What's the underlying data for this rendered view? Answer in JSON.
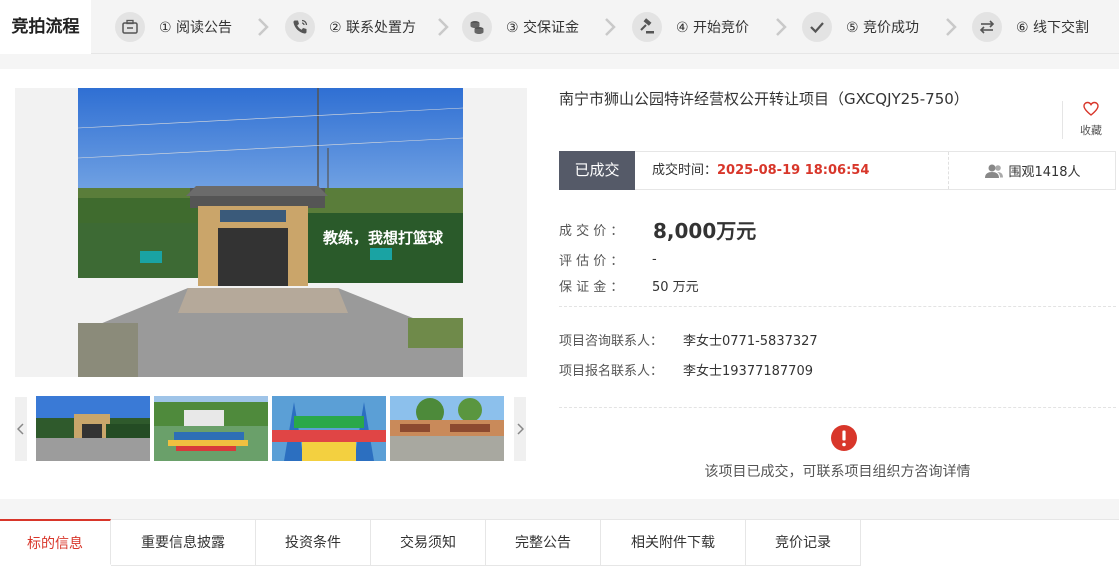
{
  "steps_title": "竞拍流程",
  "steps": [
    {
      "label": "① 阅读公告",
      "icon": "announcement-icon"
    },
    {
      "label": "② 联系处置方",
      "icon": "phone-icon"
    },
    {
      "label": "③ 交保证金",
      "icon": "coins-icon"
    },
    {
      "label": "④ 开始竞价",
      "icon": "gavel-icon"
    },
    {
      "label": "⑤ 竞价成功",
      "icon": "check-icon"
    },
    {
      "label": "⑥ 线下交割",
      "icon": "swap-icon"
    }
  ],
  "main_image": {
    "sign_text": "教练，我想打篮球"
  },
  "project": {
    "title": "南宁市狮山公园特许经营权公开转让项目（GXCQJY25-750）",
    "favorite_label": "收藏",
    "status_badge": "已成交",
    "deal_time_label": "成交时间：",
    "deal_time_value": "2025-08-19 18:06:54",
    "watch_text": "围观1418人"
  },
  "price_info": {
    "deal_price_label": "成 交 价 ：",
    "deal_price_value": "8,000万元",
    "estimate_label": "评 估 价 ：",
    "estimate_value": "-",
    "deposit_label": "保 证 金 ：",
    "deposit_value": "50 万元"
  },
  "contacts": {
    "consult_label": "项目咨询联系人：",
    "consult_value": "李女士0771-5837327",
    "register_label": "项目报名联系人：",
    "register_value": "李女士19377187709"
  },
  "notice": {
    "text": "该项目已成交，可联系项目组织方咨询详情"
  },
  "tabs": [
    "标的信息",
    "重要信息披露",
    "投资条件",
    "交易须知",
    "完整公告",
    "相关附件下载",
    "竞价记录"
  ],
  "colors": {
    "accent_red": "#d8362a",
    "badge_bg": "#555a68"
  }
}
